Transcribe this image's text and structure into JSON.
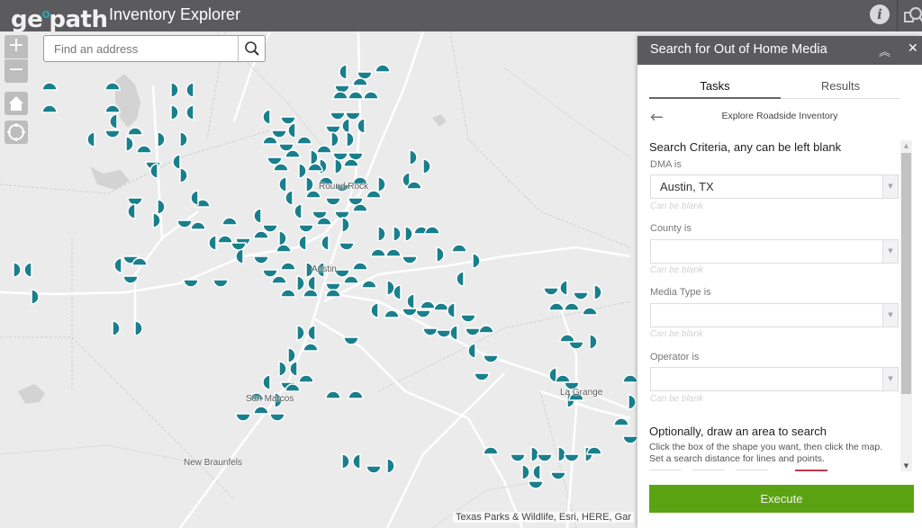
{
  "header": {
    "logo_text_pre": "ge",
    "logo_text_post": "path",
    "app_title": "Inventory Explorer",
    "info_icon": "info-icon",
    "search_media_icon": "search-media-icon"
  },
  "map": {
    "address_search": {
      "placeholder": "Find an address",
      "value": ""
    },
    "zoom_in_label": "+",
    "zoom_out_label": "−",
    "places": [
      {
        "name": "Round Rock"
      },
      {
        "name": "Austin"
      },
      {
        "name": "San Marcos"
      },
      {
        "name": "La Grange"
      },
      {
        "name": "New Braunfels"
      }
    ],
    "attribution": "Texas Parks & Wildlife, Esri, HERE, Gar",
    "marker_color": "#1a7f8c"
  },
  "panel": {
    "title": "Search for Out of Home Media",
    "tabs": [
      {
        "label": "Tasks",
        "active": true
      },
      {
        "label": "Results",
        "active": false
      }
    ],
    "task_title": "Explore Roadside Inventory",
    "criteria_heading": "Search Criteria, any can be left blank",
    "fields": [
      {
        "label": "DMA is",
        "value": "Austin, TX",
        "hint": "Can be blank"
      },
      {
        "label": "County is",
        "value": "",
        "hint": "Can be blank"
      },
      {
        "label": "Media Type is",
        "value": "",
        "hint": "Can be blank"
      },
      {
        "label": "Operator is",
        "value": "",
        "hint": "Can be blank"
      }
    ],
    "draw_heading": "Optionally, draw an area to search",
    "draw_description": "Click the box of the shape you want, then click the map. Set a search distance for lines and points.",
    "execute_label": "Execute",
    "execute_color": "#5ba313"
  }
}
